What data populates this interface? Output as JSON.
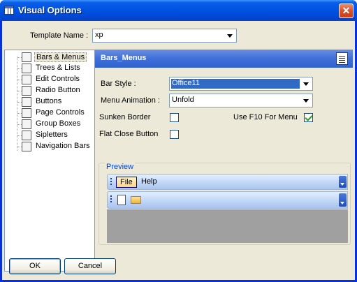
{
  "window": {
    "title": "Visual Options",
    "close_glyph": "✕"
  },
  "template": {
    "label": "Template Name :",
    "value": "xp"
  },
  "tree": {
    "items": [
      {
        "label": "Bars & Menus",
        "icon": "bars-menus-icon"
      },
      {
        "label": "Trees & Lists",
        "icon": "trees-lists-icon"
      },
      {
        "label": "Edit Controls",
        "icon": "edit-controls-icon"
      },
      {
        "label": "Radio Button",
        "icon": "radio-button-icon"
      },
      {
        "label": "Buttons",
        "icon": "buttons-icon"
      },
      {
        "label": "Page Controls",
        "icon": "page-controls-icon"
      },
      {
        "label": "Group Boxes",
        "icon": "group-boxes-icon"
      },
      {
        "label": "Sipletters",
        "icon": "sipletters-icon"
      },
      {
        "label": "Navigation Bars",
        "icon": "navigation-bars-icon"
      }
    ],
    "selected_index": 0
  },
  "panel": {
    "title": "Bars_Menus",
    "bar_style": {
      "label": "Bar Style :",
      "value": "Office11"
    },
    "menu_animation": {
      "label": "Menu Animation :",
      "value": "Unfold"
    },
    "sunken_border": {
      "label": "Sunken Border",
      "checked": false
    },
    "use_f10": {
      "label": "Use F10 For Menu",
      "checked": true
    },
    "flat_close": {
      "label": "Flat Close Button",
      "checked": false
    }
  },
  "preview": {
    "legend": "Preview",
    "menu_items": [
      "File",
      "Help"
    ],
    "toolbar_icons": [
      "new-document-icon",
      "open-folder-icon"
    ]
  },
  "buttons": {
    "ok": "OK",
    "cancel": "Cancel"
  },
  "colors": {
    "title_bar": "#0054e3",
    "panel_header": "#3f6fd8",
    "selection": "#0a246a",
    "face": "#ece9d8"
  }
}
